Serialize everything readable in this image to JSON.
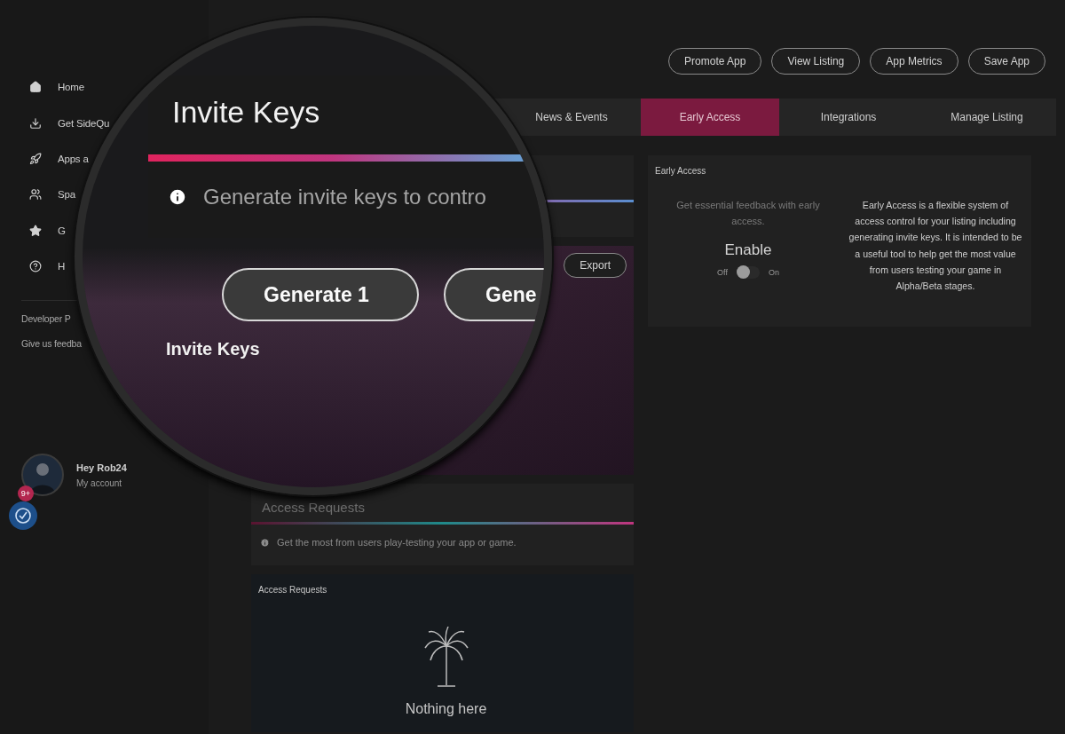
{
  "sidebar": {
    "items": [
      {
        "label": "Home"
      },
      {
        "label": "Get SideQu"
      },
      {
        "label": "Apps a"
      },
      {
        "label": "Spa"
      },
      {
        "label": "G"
      },
      {
        "label": "H"
      }
    ],
    "links": [
      "Developer P",
      "Give us feedba"
    ],
    "user": {
      "greeting": "Hey Rob24",
      "subtitle": "My account",
      "badge": "9+"
    }
  },
  "header_buttons": [
    "Promote App",
    "View Listing",
    "App Metrics",
    "Save App"
  ],
  "tabs": [
    {
      "label": "News & Events",
      "selected": false
    },
    {
      "label": "Early Access",
      "selected": true
    },
    {
      "label": "Integrations",
      "selected": false
    },
    {
      "label": "Manage Listing",
      "selected": false
    }
  ],
  "magnifier": {
    "title": "Invite Keys",
    "info": "Generate invite keys to contro",
    "buttons": [
      "Generate 1",
      "Gene"
    ],
    "label": "Invite Keys"
  },
  "invite_panel": {
    "export_button": "Export"
  },
  "access_requests": {
    "heading": "Access Requests",
    "info": "Get the most from users play-testing your app or game.",
    "panel_title": "Access Requests",
    "empty_text": "Nothing here"
  },
  "early_access": {
    "title": "Early Access",
    "lead": "Get essential feedback with early access.",
    "toggle_title": "Enable",
    "off_label": "Off",
    "on_label": "On",
    "on": false,
    "description": "Early Access is a flexible system of access control for your listing including generating invite keys. It is intended to be a useful tool to help get the most value from users testing your game in Alpha/Beta stages."
  }
}
